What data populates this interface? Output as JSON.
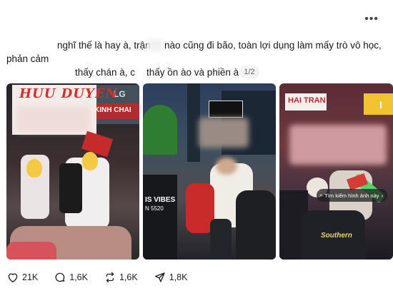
{
  "post": {
    "more_label": "•••",
    "line1a": "nghĩ thế là hay à, trận",
    "line1b": "nào cũng đi bão, toàn lợi dụng làm mấy trò vô học,",
    "line2": "phản cảm",
    "line3a": "thấy chán à, c",
    "line3b": "thấy ồn ào và phiền à",
    "image_counter": "1/2"
  },
  "images": {
    "sign_text": "HUU DUYEN",
    "sign_brand": "LG",
    "store_left": "KINH CHAI",
    "shirt_text": "IS VIBES",
    "shirt_sub": "N 5520",
    "store_right": "HAI TRAN",
    "store_right2": "I",
    "lens_label": "Tìm kiếm hình ảnh này",
    "lens_arrow": "›",
    "jacket_text": "Southern"
  },
  "actions": {
    "likes": "21K",
    "comments": "1,6K",
    "reposts": "1,6K",
    "shares": "1,8K"
  },
  "colors": {
    "accent": "#d4302a",
    "text": "#1a1a1a",
    "muted": "#666666"
  }
}
